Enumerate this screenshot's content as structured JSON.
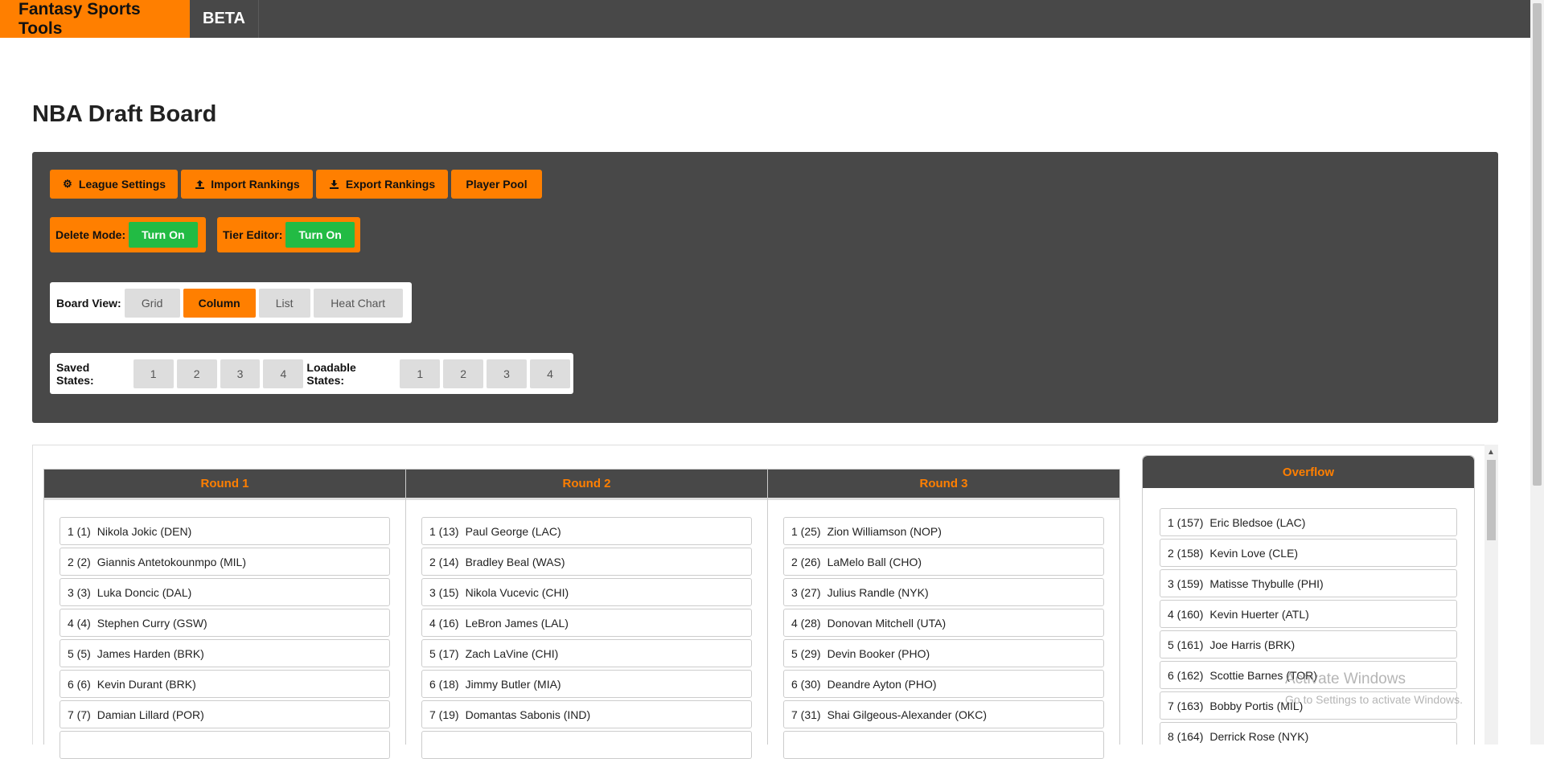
{
  "nav": {
    "brand": "Fantasy Sports Tools",
    "beta": "BETA"
  },
  "page": {
    "title": "NBA Draft Board"
  },
  "toolbar": {
    "league_settings": "League Settings",
    "import_rankings": "Import Rankings",
    "export_rankings": "Export Rankings",
    "player_pool": "Player Pool",
    "delete_mode_label": "Delete Mode:",
    "delete_mode_toggle": "Turn On",
    "tier_editor_label": "Tier Editor:",
    "tier_editor_toggle": "Turn On"
  },
  "board_view": {
    "label": "Board View:",
    "options": [
      "Grid",
      "Column",
      "List",
      "Heat Chart"
    ],
    "selected": "Column"
  },
  "states": {
    "saved_label": "Saved States:",
    "saved": [
      "1",
      "2",
      "3",
      "4"
    ],
    "loadable_label": "Loadable States:",
    "loadable": [
      "1",
      "2",
      "3",
      "4"
    ]
  },
  "rounds": [
    {
      "title": "Round 1",
      "picks": [
        {
          "num": "1 (1)",
          "player": "Nikola Jokic (DEN)"
        },
        {
          "num": "2 (2)",
          "player": "Giannis Antetokounmpo (MIL)"
        },
        {
          "num": "3 (3)",
          "player": "Luka Doncic (DAL)"
        },
        {
          "num": "4 (4)",
          "player": "Stephen Curry (GSW)"
        },
        {
          "num": "5 (5)",
          "player": "James Harden (BRK)"
        },
        {
          "num": "6 (6)",
          "player": "Kevin Durant (BRK)"
        },
        {
          "num": "7 (7)",
          "player": "Damian Lillard (POR)"
        },
        {
          "num": "",
          "player": ""
        }
      ]
    },
    {
      "title": "Round 2",
      "picks": [
        {
          "num": "1 (13)",
          "player": "Paul George (LAC)"
        },
        {
          "num": "2 (14)",
          "player": "Bradley Beal (WAS)"
        },
        {
          "num": "3 (15)",
          "player": "Nikola Vucevic (CHI)"
        },
        {
          "num": "4 (16)",
          "player": "LeBron James (LAL)"
        },
        {
          "num": "5 (17)",
          "player": "Zach LaVine (CHI)"
        },
        {
          "num": "6 (18)",
          "player": "Jimmy Butler (MIA)"
        },
        {
          "num": "7 (19)",
          "player": "Domantas Sabonis (IND)"
        },
        {
          "num": "",
          "player": ""
        }
      ]
    },
    {
      "title": "Round 3",
      "picks": [
        {
          "num": "1 (25)",
          "player": "Zion Williamson (NOP)"
        },
        {
          "num": "2 (26)",
          "player": "LaMelo Ball (CHO)"
        },
        {
          "num": "3 (27)",
          "player": "Julius Randle (NYK)"
        },
        {
          "num": "4 (28)",
          "player": "Donovan Mitchell (UTA)"
        },
        {
          "num": "5 (29)",
          "player": "Devin Booker (PHO)"
        },
        {
          "num": "6 (30)",
          "player": "Deandre Ayton (PHO)"
        },
        {
          "num": "7 (31)",
          "player": "Shai Gilgeous-Alexander (OKC)"
        },
        {
          "num": "",
          "player": ""
        }
      ]
    }
  ],
  "overflow": {
    "title": "Overflow",
    "picks": [
      {
        "num": "1 (157)",
        "player": "Eric Bledsoe (LAC)"
      },
      {
        "num": "2 (158)",
        "player": "Kevin Love (CLE)"
      },
      {
        "num": "3 (159)",
        "player": "Matisse Thybulle (PHI)"
      },
      {
        "num": "4 (160)",
        "player": "Kevin Huerter (ATL)"
      },
      {
        "num": "5 (161)",
        "player": "Joe Harris (BRK)"
      },
      {
        "num": "6 (162)",
        "player": "Scottie Barnes (TOR)"
      },
      {
        "num": "7 (163)",
        "player": "Bobby Portis (MIL)"
      },
      {
        "num": "8 (164)",
        "player": "Derrick Rose (NYK)"
      }
    ]
  },
  "watermark": {
    "line1": "Activate Windows",
    "line2": "Go to Settings to activate Windows."
  },
  "icons": {
    "settings": "gear-icon",
    "import": "upload-icon",
    "export": "download-icon"
  }
}
